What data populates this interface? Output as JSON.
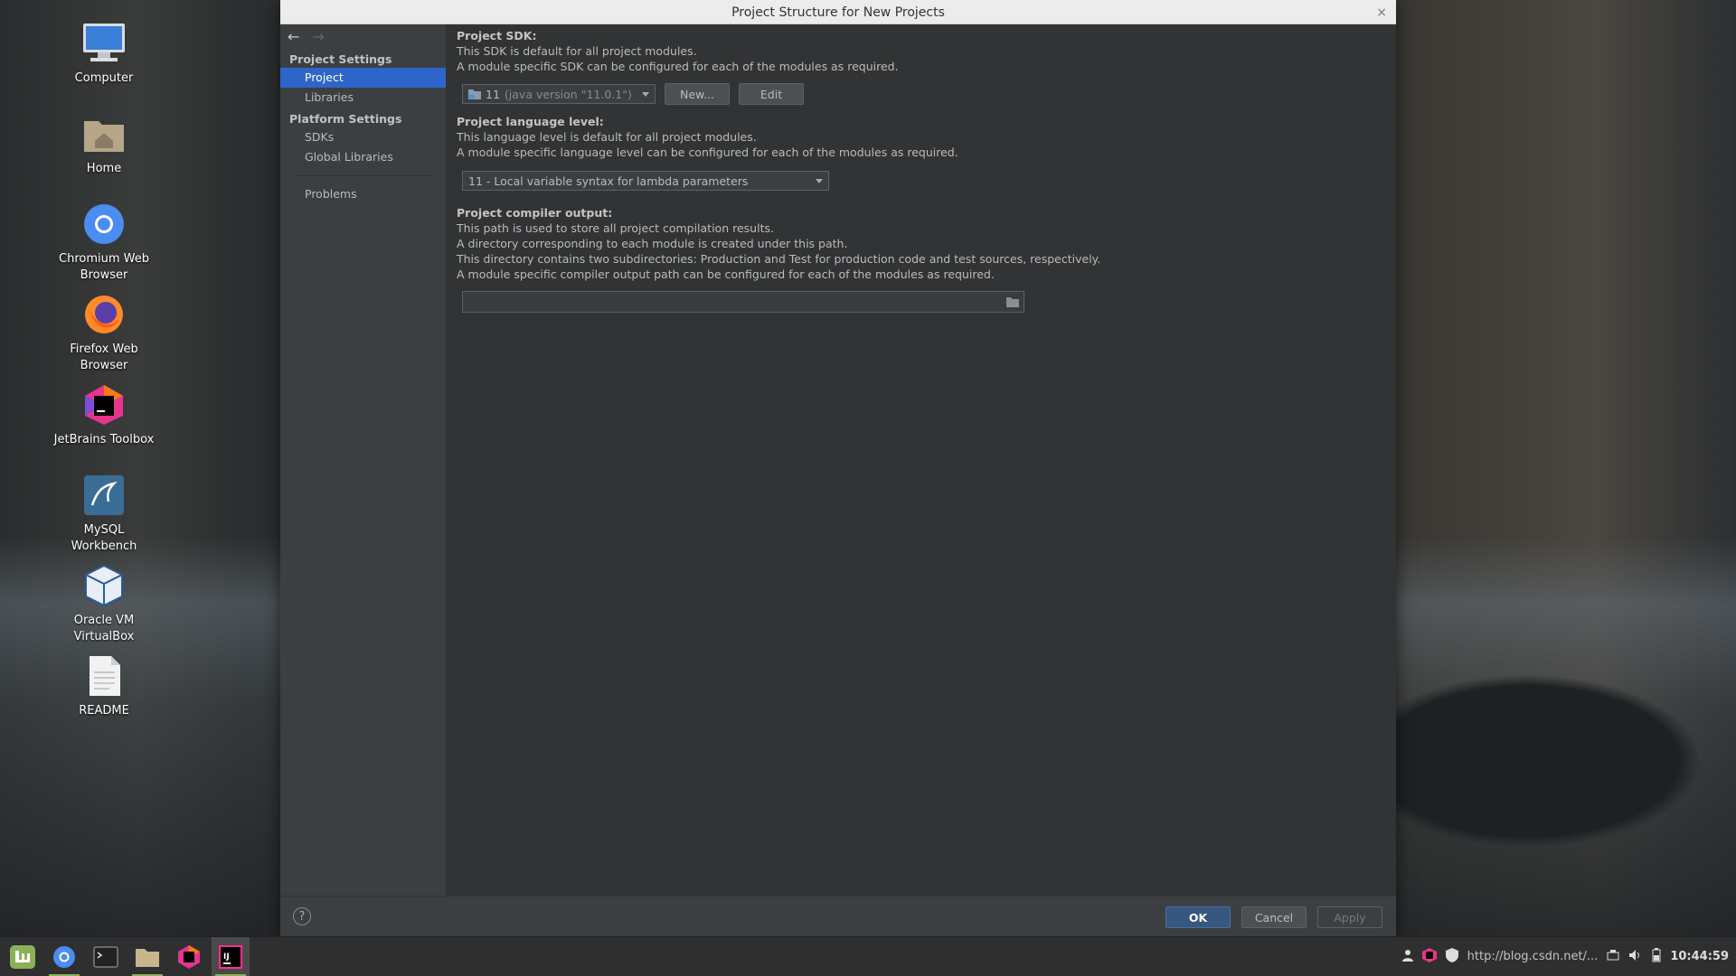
{
  "desktop": {
    "icons": [
      {
        "label": "Computer"
      },
      {
        "label": "Home"
      },
      {
        "label": "Chromium Web\nBrowser"
      },
      {
        "label": "Firefox Web\nBrowser"
      },
      {
        "label": "JetBrains Toolbox"
      },
      {
        "label": "MySQL\nWorkbench"
      },
      {
        "label": "Oracle VM\nVirtualBox"
      },
      {
        "label": "README"
      }
    ]
  },
  "dialog": {
    "title": "Project Structure for New Projects",
    "close_glyph": "×",
    "nav": {
      "back": "←",
      "forward": "→"
    },
    "sidebar": {
      "project_settings_header": "Project Settings",
      "project_items": [
        {
          "label": "Project"
        },
        {
          "label": "Libraries"
        }
      ],
      "platform_settings_header": "Platform Settings",
      "platform_items": [
        {
          "label": "SDKs"
        },
        {
          "label": "Global Libraries"
        }
      ],
      "problems": "Problems"
    },
    "sdk": {
      "header": "Project SDK:",
      "line1": "This SDK is default for all project modules.",
      "line2": "A module specific SDK can be configured for each of the modules as required.",
      "selected_version": "11",
      "selected_detail": "(java version \"11.0.1\")",
      "new_button": "New...",
      "edit_button": "Edit"
    },
    "language_level": {
      "header": "Project language level:",
      "line1": "This language level is default for all project modules.",
      "line2": "A module specific language level can be configured for each of the modules as required.",
      "selected": "11 - Local variable syntax for lambda parameters"
    },
    "compiler_output": {
      "header": "Project compiler output:",
      "line1": "This path is used to store all project compilation results.",
      "line2": "A directory corresponding to each module is created under this path.",
      "line3": "This directory contains two subdirectories: Production and Test for production code and test sources, respectively.",
      "line4": "A module specific compiler output path can be configured for each of the modules as required.",
      "path_value": ""
    },
    "footer": {
      "help": "?",
      "ok": "OK",
      "cancel": "Cancel",
      "apply": "Apply"
    }
  },
  "taskbar": {
    "apps": [
      "mint-menu-icon",
      "chromium-icon",
      "terminal-icon",
      "files-icon",
      "jetbrains-toolbox-icon",
      "intellij-icon"
    ],
    "tray_text": "http://blog.csdn.net/...",
    "clock": "10:44:59"
  },
  "colors": {
    "selection": "#2f65ca",
    "ok_button": "#365880",
    "dialog_bg": "#3c3f41",
    "panel_bg": "#313335"
  }
}
